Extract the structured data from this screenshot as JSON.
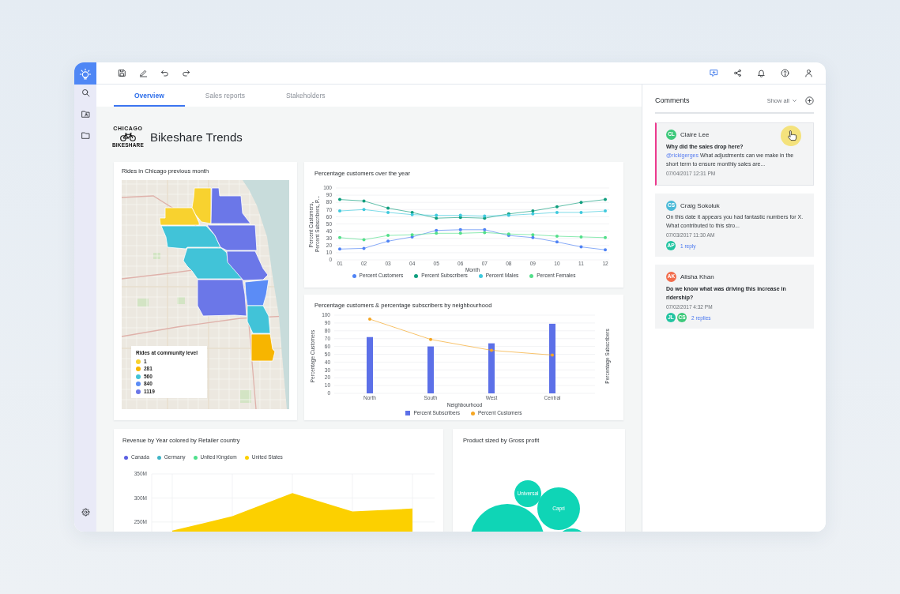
{
  "toolbar": {
    "comments_open": true
  },
  "tabs": [
    {
      "label": "Overview",
      "selected": true
    },
    {
      "label": "Sales reports",
      "selected": false
    },
    {
      "label": "Stakeholders",
      "selected": false
    }
  ],
  "header": {
    "logo_top": "CHICAGO",
    "logo_bottom": "BIKESHARE",
    "title": "Bikeshare Trends"
  },
  "map_card": {
    "title": "Rides in Chicago previous month",
    "legend": {
      "title": "Rides at community level",
      "items": [
        {
          "label": "1",
          "color": "#f8d22f"
        },
        {
          "label": "281",
          "color": "#f7b500"
        },
        {
          "label": "560",
          "color": "#41c3d8"
        },
        {
          "label": "840",
          "color": "#5b8cf6"
        },
        {
          "label": "1119",
          "color": "#6b77e8"
        }
      ]
    },
    "regions": [
      {
        "color": "#f8d22f"
      },
      {
        "color": "#f8d22f"
      },
      {
        "color": "#6b77e8"
      },
      {
        "color": "#41c3d8"
      },
      {
        "color": "#6b77e8"
      },
      {
        "color": "#41c3d8"
      },
      {
        "color": "#6b77e8"
      },
      {
        "color": "#6b77e8"
      },
      {
        "color": "#5b8cf6"
      },
      {
        "color": "#41c3d8"
      },
      {
        "color": "#f7b500"
      }
    ]
  },
  "line_chart_card": {
    "chart_data": {
      "type": "line",
      "title": "Percentage customers over the year",
      "xlabel": "Month",
      "ylabel": "Percent Customers, Percent Subscribers, P...",
      "categories": [
        "01",
        "02",
        "03",
        "04",
        "05",
        "06",
        "07",
        "08",
        "09",
        "10",
        "11",
        "12"
      ],
      "series": [
        {
          "name": "Percent Customers",
          "color": "#4f83f5",
          "values": [
            15,
            16,
            26,
            32,
            41,
            42,
            42,
            34,
            31,
            25,
            18,
            14
          ]
        },
        {
          "name": "Percent Subscribers",
          "color": "#0f9e7e",
          "values": [
            84,
            82,
            72,
            66,
            58,
            59,
            58,
            64,
            68,
            74,
            80,
            84
          ]
        },
        {
          "name": "Percent Males",
          "color": "#3ec9dd",
          "values": [
            68,
            70,
            66,
            63,
            62,
            62,
            61,
            62,
            64,
            66,
            66,
            68
          ]
        },
        {
          "name": "Percent Females",
          "color": "#52df8a",
          "values": [
            31,
            28,
            34,
            35,
            37,
            37,
            38,
            36,
            35,
            33,
            32,
            31
          ]
        }
      ],
      "ylim": [
        0,
        100
      ],
      "yticks": [
        0,
        10,
        20,
        30,
        40,
        50,
        60,
        70,
        80,
        90,
        100
      ],
      "grid": true,
      "legend": "bottom"
    }
  },
  "bar_chart_card": {
    "chart_data": {
      "type": "bar",
      "title": "Percentage customers & percentage subscribers by neighbourhood",
      "xlabel": "Neighbourhood",
      "ylabel": "Percentage Customers",
      "y2label": "Percentage Subscribers",
      "categories": [
        "North",
        "South",
        "West",
        "Central"
      ],
      "series": [
        {
          "name": "Percent Subscribers",
          "color": "#5c70e8",
          "values": [
            72,
            60,
            64,
            89
          ]
        },
        {
          "name": "Percent Customers",
          "type": "line",
          "color": "#f5a623",
          "values": [
            95,
            69,
            55,
            49
          ]
        }
      ],
      "ylim": [
        0,
        100
      ],
      "yticks": [
        0,
        10,
        20,
        30,
        40,
        50,
        60,
        70,
        80,
        90,
        100
      ],
      "grid": true,
      "legend": "bottom"
    }
  },
  "area_chart_card": {
    "chart_data": {
      "type": "area",
      "title": "Revenue by Year colored by Retailer country",
      "series": [
        {
          "name": "Canada",
          "color": "#5b5fe2",
          "values": [
            null,
            null,
            null,
            null,
            null
          ]
        },
        {
          "name": "Germany",
          "color": "#3fb4c6",
          "values": [
            null,
            null,
            null,
            null,
            null
          ]
        },
        {
          "name": "United Kingdom",
          "color": "#4fe08c",
          "values": [
            null,
            null,
            null,
            null,
            null
          ]
        },
        {
          "name": "United States",
          "color": "#fcd000",
          "values": [
            232,
            262,
            310,
            272,
            278
          ]
        }
      ],
      "ylim": [
        230,
        350
      ],
      "yticks": [
        {
          "value": 250,
          "label": "250M"
        },
        {
          "value": 300,
          "label": "300M"
        },
        {
          "value": 350,
          "label": "350M"
        }
      ],
      "grid": true,
      "legend": "top"
    }
  },
  "bubble_card": {
    "title": "Product sized by Gross profit",
    "bubbles": [
      {
        "label": "Universal"
      },
      {
        "label": "Capri"
      }
    ]
  },
  "comments": {
    "title": "Comments",
    "filter": "Show all",
    "items": [
      {
        "selected": true,
        "initials": "CL",
        "color": "#3ec97b",
        "author": "Claire Lee",
        "question": "Why did the sales drop here?",
        "mention": "@rickigerges",
        "body": "What adjustments can we make in the short term to ensure monthly sales are...",
        "date": "07/04/2017 12:31 PM"
      },
      {
        "selected": false,
        "initials": "CS",
        "color": "#4bbad8",
        "author": "Craig Sokoluk",
        "body": "On this date it appears you had fantastic numbers for X. What contributed to this stro...",
        "date": "07/03/2017 11:30 AM",
        "repliers": [
          {
            "initials": "AP",
            "color": "#22c4a1"
          }
        ],
        "replies": "1 reply"
      },
      {
        "selected": false,
        "initials": "AK",
        "color": "#f26c4c",
        "author": "Alisha Khan",
        "question": "Do we know what was driving this increase in ridership?",
        "date": "07/02/2017 4:32 PM",
        "repliers": [
          {
            "initials": "JL",
            "color": "#22c4a1"
          },
          {
            "initials": "CS",
            "color": "#3ec97b"
          }
        ],
        "replies": "2 replies"
      }
    ]
  }
}
